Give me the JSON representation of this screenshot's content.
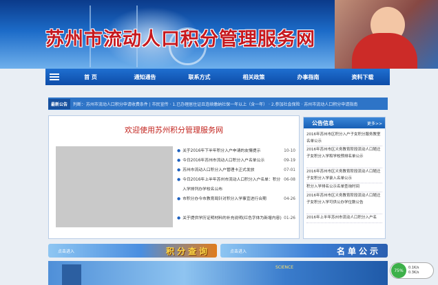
{
  "header": {
    "title": "苏州市流动人口积分管理服务网"
  },
  "nav": {
    "items": [
      "首 页",
      "通知通告",
      "联系方式",
      "相关政策",
      "办事指南",
      "资料下载"
    ]
  },
  "notice": {
    "tag": "最新公告",
    "text": "判断：· 苏州市流动人口积分申请收费条件 | 市民宣传 · 1.已办理居住证且连续缴纳社保一年以上（含一年） · 2.参加社会保险   · 苏州市流动人口积分申请指南"
  },
  "main": {
    "welcome": "欢迎使用苏州积分管理服务网",
    "news": [
      {
        "title": "关于2016年下半年积分入户申请的友情提示",
        "date": "10-10"
      },
      {
        "title": "今日2016年苏州市流动人口积分入户名单公示",
        "date": "09-19"
      },
      {
        "title": "苏州市流动人口积分入户管理卡正式发放",
        "date": "07-01"
      },
      {
        "title": "今日2016年上半年苏州市流动人口积分入户名单：积分入学排列办学校名公布",
        "date": "06-08"
      },
      {
        "title": "市积分办今市教育局针对积分入学事宜进行合期",
        "date": "04-26"
      },
      {
        "title": "关于提供学历证明材料的补充说明(红色字体为新增内容)",
        "date": "01-26"
      }
    ]
  },
  "side": {
    "title": "公告信息",
    "more": "更多>>",
    "items": [
      "2016年苏州市区积分入户子女积分服务教室名单公示",
      "2016年苏州市区义务教育阶段流动人口随迁子女积分入学和学校预排名单公示",
      "2016年苏州市区义务教育阶段流动人口随迁子女积分入学录入名单公示",
      "积分入学排名公示名单查询时间",
      "2016年苏州市区义务教育阶段流动人口随迁子女积分入学可供公办学位数公告",
      "2016年上半年苏州市流动人口积分入户名"
    ]
  },
  "strips": {
    "left_label": "积分查询",
    "left_sub": "点击进入",
    "right_label": "名单公示",
    "right_sub": "点击进入"
  },
  "bottom": {
    "science": "SCIENCE"
  },
  "widget": {
    "circle": "75%",
    "up": "0.1K/s",
    "down": "0.3K/s"
  }
}
